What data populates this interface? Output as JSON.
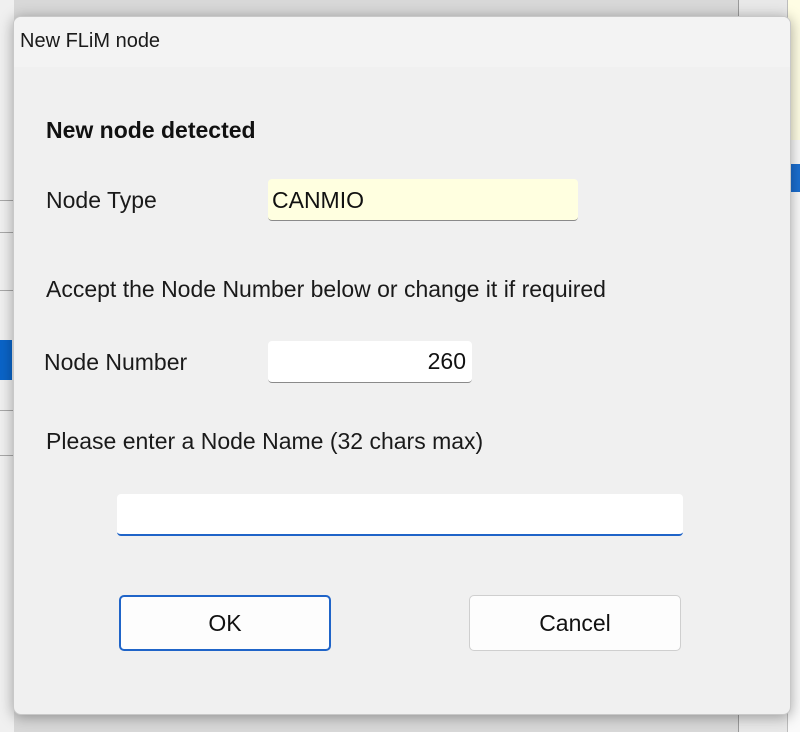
{
  "dialog": {
    "title": "New FLiM node",
    "heading": "New node detected",
    "node_type": {
      "label": "Node Type",
      "value": "CANMIO"
    },
    "instructions": "Accept the Node Number below or change it if required",
    "node_number": {
      "label": "Node Number",
      "value": "260"
    },
    "node_name": {
      "prompt": "Please enter a Node Name (32 chars max)",
      "value": ""
    },
    "buttons": {
      "ok_label": "OK",
      "cancel_label": "Cancel"
    }
  },
  "colors": {
    "accent": "#1f64c8",
    "readonly_field_bg": "#ffffe0",
    "dialog_bg": "#f0f0f0"
  }
}
